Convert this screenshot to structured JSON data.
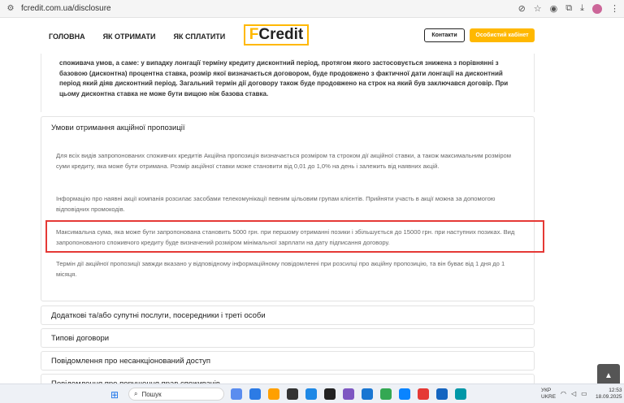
{
  "browser": {
    "url": "fcredit.com.ua/disclosure"
  },
  "header": {
    "nav": [
      "ГОЛОВНА",
      "ЯК ОТРИМАТИ",
      "ЯК СПЛАТИТИ"
    ],
    "logo_f": "F",
    "logo_rest": "Credit",
    "contacts_label": "Контакти",
    "cabinet_label": "Особистий кабінет"
  },
  "intro_text": "споживача умов, а саме: у випадку лонгації терміну кредиту дисконтний період, протягом якого застосовується знижена з порівнянні з базовою (дисконтна) процентна ставка, розмір якої визначається договором, буде продовжено з фактичної дати лонгації на дисконтний період який діяв дисконтний період. Загальний термін дії договору також буде продовжено на строк на який був заключався договір. При цьому дисконтна ставка не може бути вищою ніж базова ставка.",
  "promo": {
    "title": "Умови отримання акційної пропозиції",
    "paragraphs": [
      "Для всіх видів запропонованих споживчих кредитів Акційна пропозиція визначається розміром та строком дії акційної ставки, а також максимальним розміром суми кредиту, яка може бути отримана. Розмір акційної ставки може становити від 0,01 до 1,0% на день і залежить від наявних акцій.",
      "Інформацію про наявні акції компанія розсилає засобами телекомунікації певним цільовим групам клієнтів. Прийняти участь в акції можна за допомогою відповідних промокодів.",
      "Максимальна сума, яка може бути запропонована становить 5000 грн. при першому отриманні позики і збільшується до 15000 грн. при наступних позиках. Вид запропонованого споживчого кредиту буде визначений розміром мінімальної зарплати на дату підписання договору.",
      "Термін дії акційної пропозиції завжди вказано у відповідному інформаційному повідомленні при розсилці про акційну пропозицію, та він буває від 1 дня до 1 місяця."
    ]
  },
  "accordion": [
    "Додаткові та/або супутні послуги, посередники і треті особи",
    "Типові договори",
    "Повідомлення про несанкціонований доступ",
    "Повідомлення про порушення прав споживачів"
  ],
  "taskbar": {
    "search_label": "Пошук",
    "lang": "УКР",
    "layout": "UKRE",
    "time": "12:53",
    "date": "18.09.2025"
  }
}
